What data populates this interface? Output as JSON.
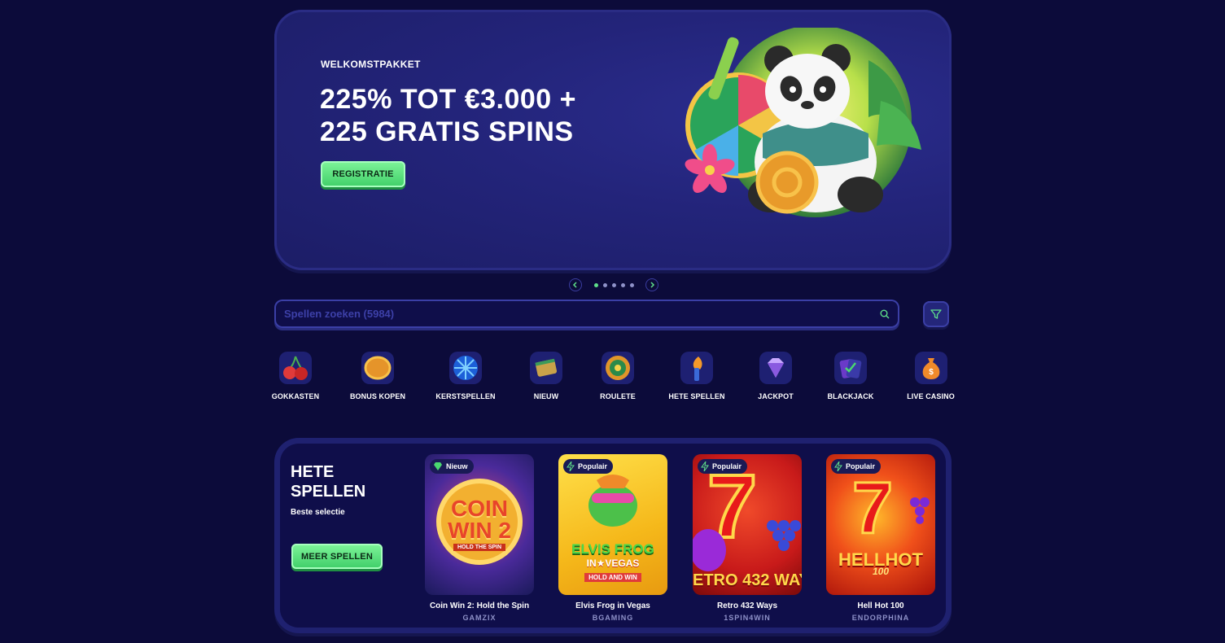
{
  "hero": {
    "eyebrow": "WELKOMSTPAKKET",
    "title_line1": "225% TOT €3.000 +",
    "title_line2": "225 GRATIS SPINS",
    "cta": "REGISTRATIE"
  },
  "carousel": {
    "slides": 5,
    "active": 1
  },
  "search": {
    "placeholder": "Spellen zoeken (5984)"
  },
  "categories": [
    {
      "label": "GOKKASTEN",
      "icon": "cherries-icon"
    },
    {
      "label": "BONUS KOPEN",
      "icon": "coin-icon"
    },
    {
      "label": "KERSTSPELLEN",
      "icon": "snowflake-icon"
    },
    {
      "label": "NIEUW",
      "icon": "scroll-icon"
    },
    {
      "label": "ROULETE",
      "icon": "roulette-icon"
    },
    {
      "label": "HETE SPELLEN",
      "icon": "torch-icon"
    },
    {
      "label": "JACKPOT",
      "icon": "diamond-icon"
    },
    {
      "label": "BLACKJACK",
      "icon": "cards-icon"
    },
    {
      "label": "LIVE CASINO",
      "icon": "money-bag-icon"
    }
  ],
  "hot_games": {
    "title_line1": "HETE",
    "title_line2": "SPELLEN",
    "subtitle": "Beste selectie",
    "cta": "MEER SPELLEN",
    "games": [
      {
        "badge": "Nieuw",
        "name": "Coin Win 2: Hold the Spin",
        "provider": "GAMZIX",
        "art1": "COIN",
        "art2": "WIN 2",
        "art3": "HOLD THE SPIN"
      },
      {
        "badge": "Populair",
        "name": "Elvis Frog in Vegas",
        "provider": "BGAMING",
        "art1": "ELVIS FROG",
        "art2": "IN★VEGAS",
        "art3": "HOLD AND WIN"
      },
      {
        "badge": "Populair",
        "name": "Retro 432 Ways",
        "provider": "1SPIN4WIN",
        "art1": "7",
        "art2": "ETRO 432 WAY",
        "art3": ""
      },
      {
        "badge": "Populair",
        "name": "Hell Hot 100",
        "provider": "ENDORPHINA",
        "art1": "7",
        "art2": "HELLHOT",
        "art3": "100"
      }
    ]
  },
  "colors": {
    "bg": "#0c0b3a",
    "accent_green": "#5fe08a",
    "panel": "#23247a"
  }
}
